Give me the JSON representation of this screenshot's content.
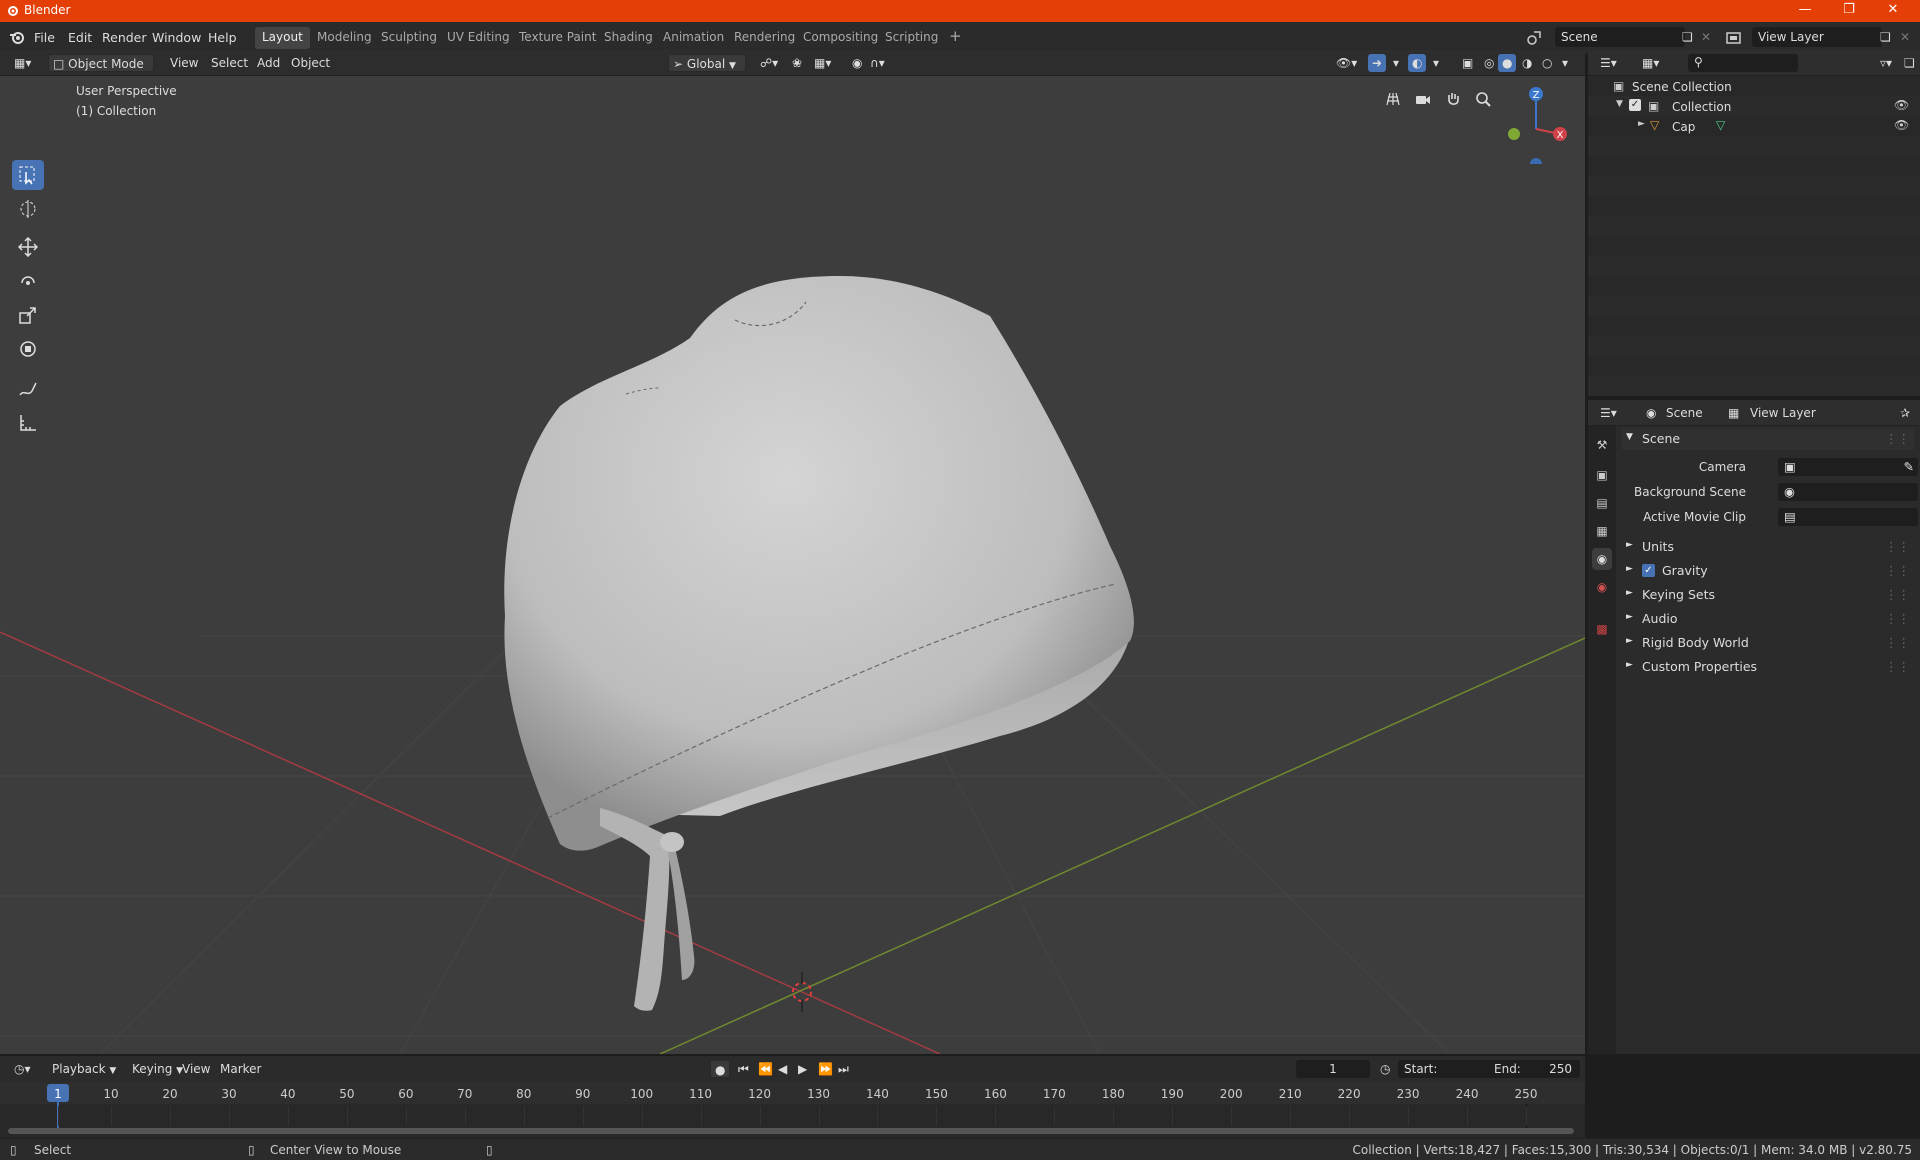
{
  "app": {
    "title": "Blender"
  },
  "colors": {
    "accent": "#e43f06",
    "selection": "#4772b3",
    "axis_x": "#d0414a",
    "axis_y": "#80a834",
    "axis_z": "#3a79ce"
  },
  "menus": [
    "File",
    "Edit",
    "Render",
    "Window",
    "Help"
  ],
  "workspaces": [
    "Layout",
    "Modeling",
    "Sculpting",
    "UV Editing",
    "Texture Paint",
    "Shading",
    "Animation",
    "Rendering",
    "Compositing",
    "Scripting"
  ],
  "active_workspace": "Layout",
  "scene": {
    "name": "Scene",
    "view_layer": "View Layer"
  },
  "viewport": {
    "mode": "Object Mode",
    "menus": [
      "View",
      "Select",
      "Add",
      "Object"
    ],
    "orientation": "Global",
    "overlay_text": [
      "User Perspective",
      "(1) Collection"
    ],
    "gizmo": {
      "z": "Z",
      "x": "X"
    }
  },
  "outliner": {
    "root": "Scene Collection",
    "items": [
      {
        "label": "Collection",
        "icon": "collection-icon"
      },
      {
        "label": "Cap",
        "icon": "mesh-object-icon"
      }
    ]
  },
  "properties": {
    "tab_scene": "Scene",
    "tab_viewlayer": "View Layer",
    "panel_title": "Scene",
    "fields": [
      {
        "label": "Camera"
      },
      {
        "label": "Background Scene"
      },
      {
        "label": "Active Movie Clip"
      }
    ],
    "subpanels": [
      "Units",
      "Gravity",
      "Keying Sets",
      "Audio",
      "Rigid Body World",
      "Custom Properties"
    ],
    "gravity_checked": true
  },
  "timeline": {
    "menus": [
      "Playback",
      "Keying",
      "View",
      "Marker"
    ],
    "current_frame": "1",
    "start_label": "Start:",
    "start": "1",
    "end_label": "End:",
    "end": "250",
    "ticks": [
      "1",
      "10",
      "20",
      "30",
      "40",
      "50",
      "60",
      "70",
      "80",
      "90",
      "100",
      "110",
      "120",
      "130",
      "140",
      "150",
      "160",
      "170",
      "180",
      "190",
      "200",
      "210",
      "220",
      "230",
      "240",
      "250"
    ]
  },
  "status": {
    "left": "Select",
    "middle": "Center View to Mouse",
    "right": "Collection | Verts:18,427 | Faces:15,300 | Tris:30,534 | Objects:0/1 | Mem: 34.0 MB | v2.80.75"
  }
}
